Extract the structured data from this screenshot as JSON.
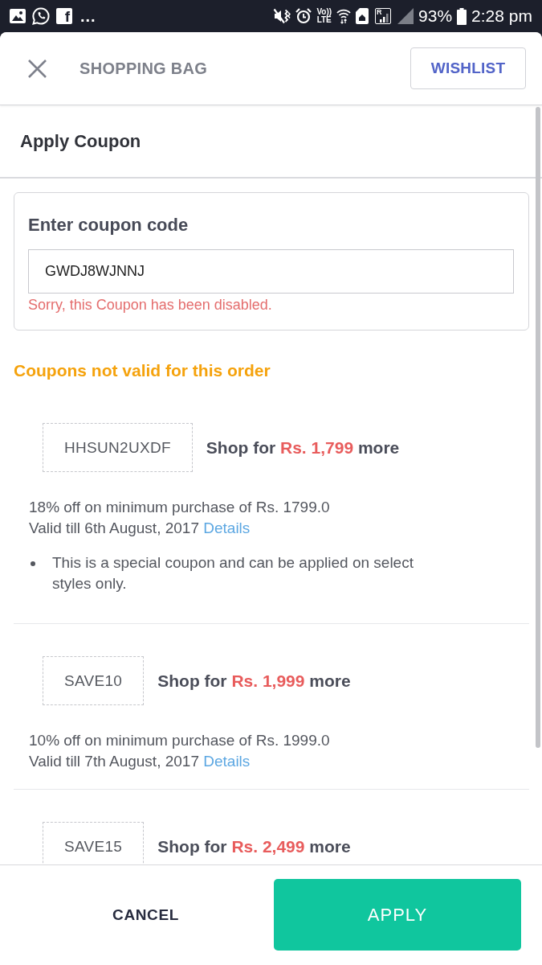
{
  "status_bar": {
    "more": "...",
    "app_letter": "f",
    "network_labels": [
      "Vo))",
      "LTE"
    ],
    "roaming_letter": "R",
    "battery": "93%",
    "time": "2:28 pm"
  },
  "header": {
    "title": "SHOPPING BAG",
    "wishlist_button": "WISHLIST"
  },
  "section_title": "Apply Coupon",
  "coupon_entry": {
    "label": "Enter coupon code",
    "value": "GWDJ8WJNNJ",
    "error": "Sorry, this Coupon has been disabled."
  },
  "invalid_coupons": {
    "heading": "Coupons not valid for this order",
    "items": [
      {
        "code": "HHSUN2UXDF",
        "requirement": {
          "before": "Shop for",
          "amount": "Rs. 1,799",
          "after": "more"
        },
        "description": "18% off on minimum purchase of Rs. 1799.0",
        "validity": "Valid till 6th August, 2017",
        "details_link": "Details",
        "notes": [
          "This is a special coupon and can be applied on select styles only."
        ]
      },
      {
        "code": "SAVE10",
        "requirement": {
          "before": "Shop for",
          "amount": "Rs. 1,999",
          "after": "more"
        },
        "description": "10% off on minimum purchase of Rs. 1999.0",
        "validity": "Valid till 7th August, 2017",
        "details_link": "Details"
      },
      {
        "code": "SAVE15",
        "requirement": {
          "before": "Shop for",
          "amount": "Rs. 2,499",
          "after": "more"
        }
      }
    ]
  },
  "footer": {
    "cancel_button": "CANCEL",
    "apply_button": "APPLY"
  }
}
